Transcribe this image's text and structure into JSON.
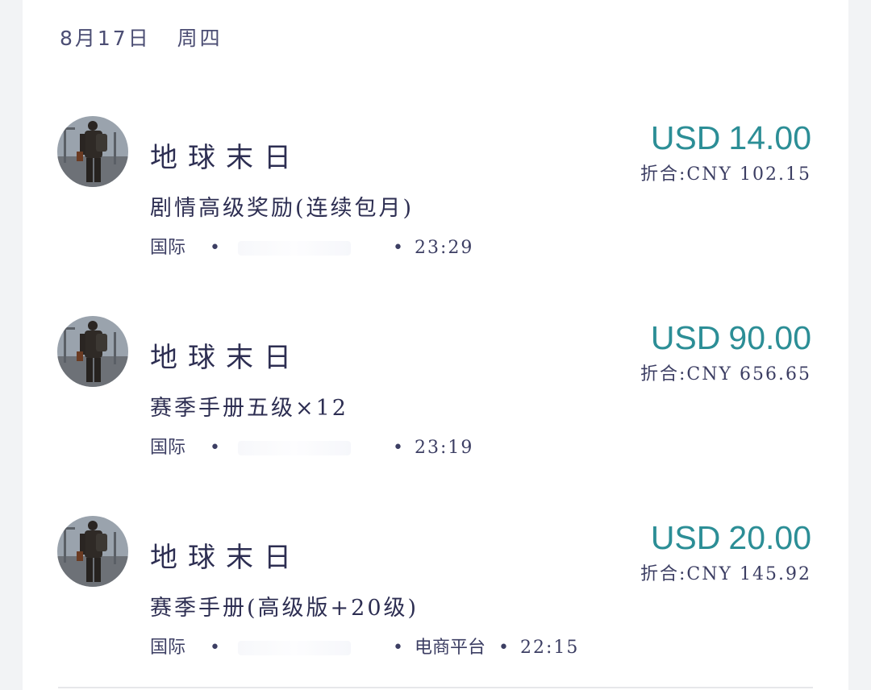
{
  "date_header": {
    "date": "8月17日",
    "weekday": "周四"
  },
  "transactions": [
    {
      "game": "地球末日",
      "item": "剧情高级奖励(连续包月)",
      "region": "国际",
      "time": "23:29",
      "currency": "USD",
      "amount": "14.00",
      "converted": "折合:CNY 102.15"
    },
    {
      "game": "地球末日",
      "item": "赛季手册五级×12",
      "region": "国际",
      "time": "23:19",
      "currency": "USD",
      "amount": "90.00",
      "converted": "折合:CNY 656.65"
    },
    {
      "game": "地球末日",
      "item": "赛季手册(高级版+20级)",
      "region": "国际",
      "platform": "电商平台",
      "time": "22:15",
      "currency": "USD",
      "amount": "20.00",
      "converted": "折合:CNY 145.92"
    }
  ],
  "colors": {
    "amount": "#2c8e96",
    "text": "#2d2e52",
    "page_background": "#f2f3f5",
    "card_background": "#ffffff"
  },
  "icons": {
    "avatar": "game-avatar-soldier"
  }
}
